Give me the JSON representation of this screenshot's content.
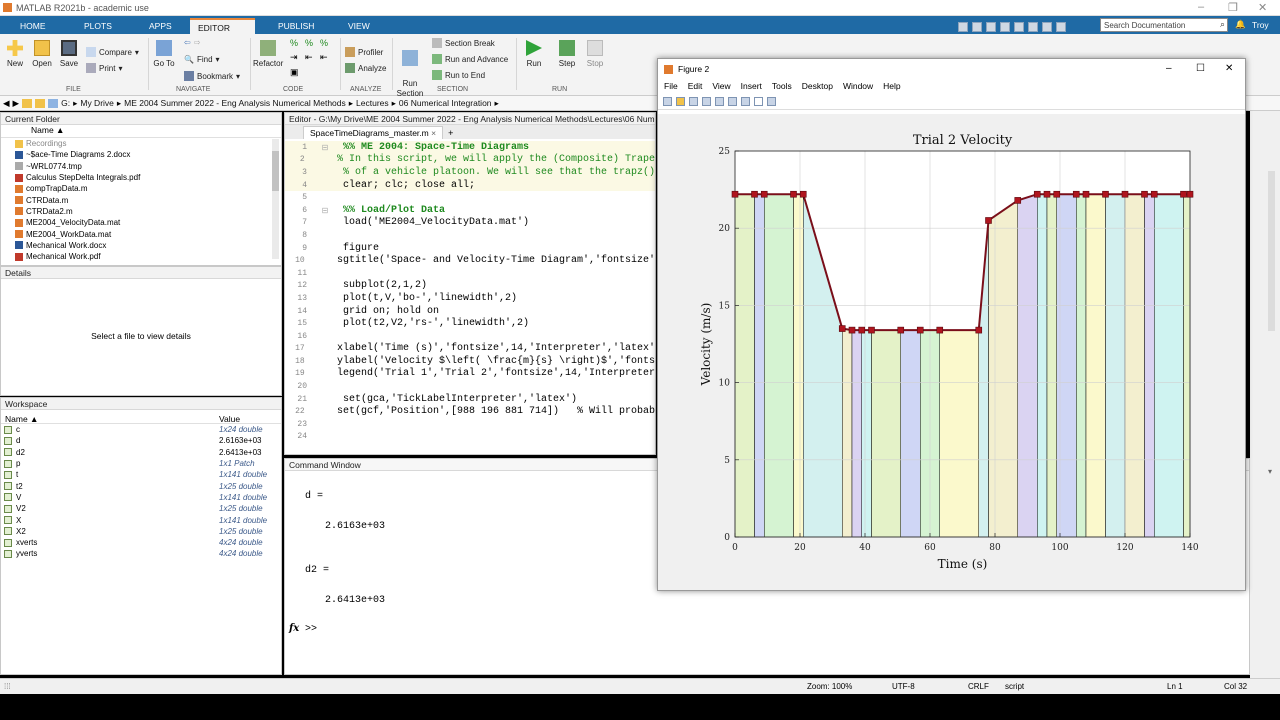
{
  "app": {
    "title": "MATLAB R2021b - academic use",
    "user": "Troy",
    "search_placeholder": "Search Documentation"
  },
  "tabs": [
    "HOME",
    "PLOTS",
    "APPS",
    "EDITOR",
    "PUBLISH",
    "VIEW"
  ],
  "ribbon": {
    "new": "New",
    "open": "Open",
    "save": "Save",
    "compare": "Compare",
    "print": "Print",
    "goto": "Go To",
    "find": "Find",
    "bookmark": "Bookmark",
    "refactor": "Refactor",
    "profiler": "Profiler",
    "analyze": "Analyze",
    "run_section": "Run\nSection",
    "section_break": "Section Break",
    "run_and_advance": "Run and Advance",
    "run_to_end": "Run to End",
    "run": "Run",
    "step": "Step",
    "stop": "Stop",
    "groups": {
      "file": "FILE",
      "navigate": "NAVIGATE",
      "code": "CODE",
      "analyze": "ANALYZE",
      "section": "SECTION",
      "run": "RUN"
    }
  },
  "address": [
    "G:",
    "My Drive",
    "ME 2004 Summer 2022 - Eng Analysis Numerical Methods",
    "Lectures",
    "06 Numerical Integration"
  ],
  "current_folder": {
    "title": "Current Folder",
    "column": "Name",
    "files": [
      "Recordings",
      "~$ace-Time Diagrams 2.docx",
      "~WRL0774.tmp",
      "Calculus StepDelta Integrals.pdf",
      "compTrapData.m",
      "CTRData.m",
      "CTRData2.m",
      "ME2004_VelocityData.mat",
      "ME2004_WorkData.mat",
      "Mechanical Work.docx",
      "Mechanical Work.pdf"
    ]
  },
  "details": {
    "title": "Details",
    "message": "Select a file to view details"
  },
  "workspace": {
    "title": "Workspace",
    "col_name": "Name",
    "col_value": "Value",
    "vars": [
      [
        "c",
        "1x24 double"
      ],
      [
        "d",
        "2.6163e+03"
      ],
      [
        "d2",
        "2.6413e+03"
      ],
      [
        "p",
        "1x1 Patch"
      ],
      [
        "t",
        "1x141 double"
      ],
      [
        "t2",
        "1x25 double"
      ],
      [
        "V",
        "1x141 double"
      ],
      [
        "V2",
        "1x25 double"
      ],
      [
        "X",
        "1x141 double"
      ],
      [
        "X2",
        "1x25 double"
      ],
      [
        "xverts",
        "4x24 double"
      ],
      [
        "yverts",
        "4x24 double"
      ]
    ]
  },
  "editor": {
    "title": "Editor - G:\\My Drive\\ME 2004 Summer 2022 - Eng Analysis Numerical Methods\\Lectures\\06 Numerical",
    "tab": "SpaceTimeDiagrams_master.m",
    "lines": [
      "%% ME 2004: Space-Time Diagrams",
      "% In this script, we will apply the (Composite) Trape",
      "% of a vehicle platoon. We will see that the trapz()",
      "clear; clc; close all;",
      "",
      "%% Load/Plot Data",
      "load('ME2004_VelocityData.mat')",
      "",
      "figure",
      "sgtitle('Space- and Velocity-Time Diagram','fontsize'",
      "",
      "subplot(2,1,2)",
      "plot(t,V,'bo-','linewidth',2)",
      "grid on; hold on",
      "plot(t2,V2,'rs-','linewidth',2)",
      "",
      "xlabel('Time (s)','fontsize',14,'Interpreter','latex'",
      "ylabel('Velocity $\\left( \\frac{m}{s} \\right)$','fonts",
      "legend('Trial 1','Trial 2','fontsize',14,'Interpreter",
      "",
      "set(gca,'TickLabelInterpreter','latex')",
      "set(gcf,'Position',[988 196 881 714])   % Will probab",
      "",
      ""
    ]
  },
  "command_window": {
    "title": "Command Window",
    "out1_name": "d =",
    "out1_val": "2.6163e+03",
    "out2_name": "d2 =",
    "out2_val": "2.6413e+03",
    "prompt": ">>"
  },
  "status": {
    "zoom": "Zoom: 100%",
    "encoding": "UTF-8",
    "eol": "CRLF",
    "type": "script",
    "ln": "Ln  1",
    "col": "Col  32"
  },
  "figure": {
    "title": "Figure 2",
    "menus": [
      "File",
      "Edit",
      "View",
      "Insert",
      "Tools",
      "Desktop",
      "Window",
      "Help"
    ]
  },
  "chart_data": {
    "type": "line",
    "title": "Trial 2 Velocity",
    "xlabel": "Time (s)",
    "ylabel": "Velocity (m/s)",
    "xlim": [
      0,
      140
    ],
    "ylim": [
      0,
      25
    ],
    "xticks": [
      0,
      20,
      40,
      60,
      80,
      100,
      120,
      140
    ],
    "yticks": [
      0,
      5,
      10,
      15,
      20,
      25
    ],
    "grid": true,
    "line_color": "#7a0f1a",
    "marker": "square",
    "marker_color": "#b0151e",
    "x": [
      0,
      6,
      9,
      18,
      21,
      33,
      36,
      39,
      42,
      51,
      57,
      63,
      75,
      78,
      87,
      93,
      96,
      99,
      105,
      108,
      114,
      120,
      126,
      129,
      138,
      140
    ],
    "y": [
      22.2,
      22.2,
      22.2,
      22.2,
      22.2,
      13.5,
      13.4,
      13.4,
      13.4,
      13.4,
      13.4,
      13.4,
      13.4,
      20.5,
      21.8,
      22.2,
      22.2,
      22.2,
      22.2,
      22.2,
      22.2,
      22.2,
      22.2,
      22.2,
      22.2,
      22.2
    ],
    "patch_colors": [
      "#e4f2c8",
      "#cfd6f5",
      "#d5f3d2",
      "#fbf9cc",
      "#d3f0ef",
      "#f3efcf",
      "#dad3f2",
      "#cff3f1"
    ]
  }
}
